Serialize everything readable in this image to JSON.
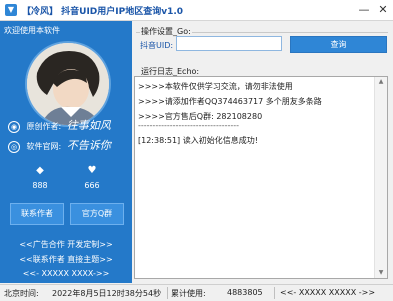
{
  "window": {
    "title": "【冷风】 抖音UID用户IP地区查询v1.0",
    "minimize": "—",
    "close": "✕"
  },
  "sidebar": {
    "welcome": "欢迎使用本软件",
    "author_label": "原创作者:",
    "author_value": "往事如风",
    "site_label": "软件官网:",
    "site_value": "不告诉你",
    "stat_left": "888",
    "stat_right": "666",
    "contact_button": "联系作者",
    "group_button": "官方Q群",
    "promo_line1": "<<广告合作  开发定制>>",
    "promo_line2": "<<联系作者  直接主题>>",
    "promo_line3": "<<- XXXXX XXXX->>"
  },
  "settings": {
    "group_title": "操作设置_Go:",
    "uid_label": "抖音UID:",
    "uid_value": "",
    "query_button": "查询"
  },
  "log": {
    "group_title": "运行日志_Echo:",
    "lines": [
      ">>>>本软件仅供学习交流，请勿非法使用",
      ">>>>请添加作者QQ374463717  多个朋友多条路",
      ">>>>官方售后Q群: 282108280",
      "-----------------------------------",
      "[12:38:51]  读入初始化信息成功!"
    ]
  },
  "statusbar": {
    "time_label": "北京时间:",
    "time_value": "2022年8月5日12时38分54秒",
    "usage_label": "累计使用:",
    "usage_value": "4883805",
    "extra": "<<- XXXXX XXXXX ->>"
  }
}
